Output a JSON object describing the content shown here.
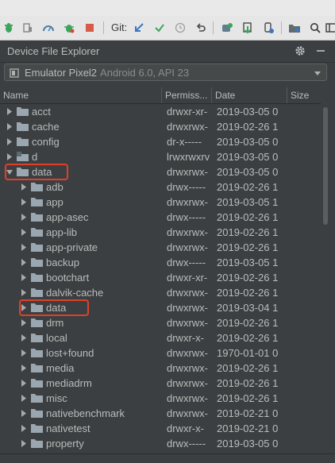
{
  "toolbar": {
    "git_label": "Git:",
    "icons": [
      "bug-icon",
      "attach-icon",
      "profile-icon",
      "debug-icon",
      "stop-icon",
      "git-update-icon",
      "git-commit-icon",
      "history-icon",
      "revert-icon",
      "avd-manager-icon",
      "sdk-manager-icon",
      "device-icon",
      "project-structure-icon",
      "search-icon",
      "layout-icon"
    ]
  },
  "panel": {
    "title": "Device File Explorer",
    "settings_icon": "gear-icon",
    "hide_icon": "minimize-icon"
  },
  "device": {
    "name": "Emulator Pixel2",
    "api": "Android 6.0, API 23"
  },
  "columns": {
    "name": "Name",
    "permissions": "Permiss...",
    "date": "Date",
    "size": "Size"
  },
  "rows": [
    {
      "name": "acct",
      "permissions": "drwxr-xr-",
      "date": "2019-03-05 0",
      "level": 0,
      "expanded": false,
      "type": "folder"
    },
    {
      "name": "cache",
      "permissions": "drwxrwx-",
      "date": "2019-02-26 1",
      "level": 0,
      "expanded": false,
      "type": "folder"
    },
    {
      "name": "config",
      "permissions": "dr-x-----",
      "date": "2019-03-05 0",
      "level": 0,
      "expanded": false,
      "type": "folder"
    },
    {
      "name": "d",
      "permissions": "lrwxrwxrv",
      "date": "2019-03-05 0",
      "level": 0,
      "expanded": false,
      "type": "link"
    },
    {
      "name": "data",
      "permissions": "drwxrwx-",
      "date": "2019-03-05 0",
      "level": 0,
      "expanded": true,
      "type": "folder",
      "highlighted": true
    },
    {
      "name": "adb",
      "permissions": "drwx-----",
      "date": "2019-02-26 1",
      "level": 1,
      "expanded": false,
      "type": "folder"
    },
    {
      "name": "app",
      "permissions": "drwxrwx-",
      "date": "2019-03-05 1",
      "level": 1,
      "expanded": false,
      "type": "folder"
    },
    {
      "name": "app-asec",
      "permissions": "drwx-----",
      "date": "2019-02-26 1",
      "level": 1,
      "expanded": false,
      "type": "folder"
    },
    {
      "name": "app-lib",
      "permissions": "drwxrwx-",
      "date": "2019-02-26 1",
      "level": 1,
      "expanded": false,
      "type": "folder"
    },
    {
      "name": "app-private",
      "permissions": "drwxrwx-",
      "date": "2019-02-26 1",
      "level": 1,
      "expanded": false,
      "type": "folder"
    },
    {
      "name": "backup",
      "permissions": "drwx-----",
      "date": "2019-03-05 1",
      "level": 1,
      "expanded": false,
      "type": "folder"
    },
    {
      "name": "bootchart",
      "permissions": "drwxr-xr-",
      "date": "2019-02-26 1",
      "level": 1,
      "expanded": false,
      "type": "folder"
    },
    {
      "name": "dalvik-cache",
      "permissions": "drwxrwx-",
      "date": "2019-02-26 1",
      "level": 1,
      "expanded": false,
      "type": "folder"
    },
    {
      "name": "data",
      "permissions": "drwxrwx-",
      "date": "2019-03-04 1",
      "level": 1,
      "expanded": false,
      "type": "folder",
      "highlighted": true
    },
    {
      "name": "drm",
      "permissions": "drwxrwx-",
      "date": "2019-02-26 1",
      "level": 1,
      "expanded": false,
      "type": "folder"
    },
    {
      "name": "local",
      "permissions": "drwxr-x-",
      "date": "2019-02-26 1",
      "level": 1,
      "expanded": false,
      "type": "folder"
    },
    {
      "name": "lost+found",
      "permissions": "drwxrwx-",
      "date": "1970-01-01 0",
      "level": 1,
      "expanded": false,
      "type": "folder"
    },
    {
      "name": "media",
      "permissions": "drwxrwx-",
      "date": "2019-02-26 1",
      "level": 1,
      "expanded": false,
      "type": "folder"
    },
    {
      "name": "mediadrm",
      "permissions": "drwxrwx-",
      "date": "2019-02-26 1",
      "level": 1,
      "expanded": false,
      "type": "folder"
    },
    {
      "name": "misc",
      "permissions": "drwxrwx-",
      "date": "2019-02-26 1",
      "level": 1,
      "expanded": false,
      "type": "folder"
    },
    {
      "name": "nativebenchmark",
      "permissions": "drwxrwx-",
      "date": "2019-02-21 0",
      "level": 1,
      "expanded": false,
      "type": "folder"
    },
    {
      "name": "nativetest",
      "permissions": "drwxr-x-",
      "date": "2019-02-21 0",
      "level": 1,
      "expanded": false,
      "type": "folder"
    },
    {
      "name": "property",
      "permissions": "drwx-----",
      "date": "2019-03-05 0",
      "level": 1,
      "expanded": false,
      "type": "folder"
    }
  ],
  "colors": {
    "panel_bg": "#3c3f41",
    "text": "#bbbbbb",
    "folder": "#9aa7b0",
    "highlight": "#e0402a",
    "toolbar_bg": "#e6e6e6"
  }
}
